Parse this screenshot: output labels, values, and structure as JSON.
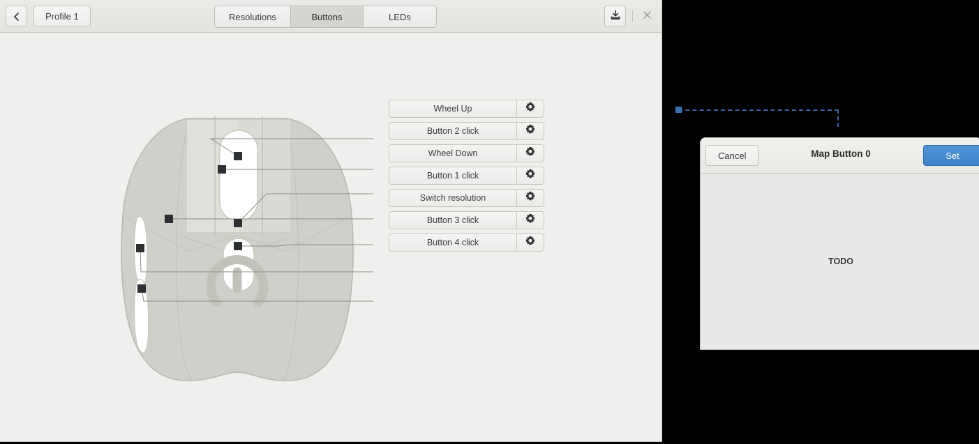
{
  "window": {
    "headerbar": {
      "back_icon": "chevron-left-icon",
      "profile_label": "Profile 1",
      "save_icon": "save-download-icon",
      "close_icon": "close-icon",
      "tabs": [
        {
          "label": "Resolutions",
          "active": false
        },
        {
          "label": "Buttons",
          "active": true
        },
        {
          "label": "LEDs",
          "active": false
        }
      ]
    }
  },
  "content": {
    "diagram": {
      "name": "mouse-diagram",
      "logo_icon": "power-ring-logo",
      "marker_count": 7
    },
    "button_mappings": [
      {
        "label": "Wheel Up",
        "gear_icon": "gear-icon"
      },
      {
        "label": "Button 2 click",
        "gear_icon": "gear-icon"
      },
      {
        "label": "Wheel Down",
        "gear_icon": "gear-icon"
      },
      {
        "label": "Button 1 click",
        "gear_icon": "gear-icon"
      },
      {
        "label": "Switch resolution",
        "gear_icon": "gear-icon"
      },
      {
        "label": "Button 3 click",
        "gear_icon": "gear-icon"
      },
      {
        "label": "Button 4 click",
        "gear_icon": "gear-icon"
      }
    ]
  },
  "selection": {
    "name": "drag-selection-outline",
    "color": "#3465a4"
  },
  "dialog": {
    "cancel_label": "Cancel",
    "title": "Map Button 0",
    "set_label": "Set",
    "body_text": "TODO",
    "accent_color": "#4a90d9"
  }
}
